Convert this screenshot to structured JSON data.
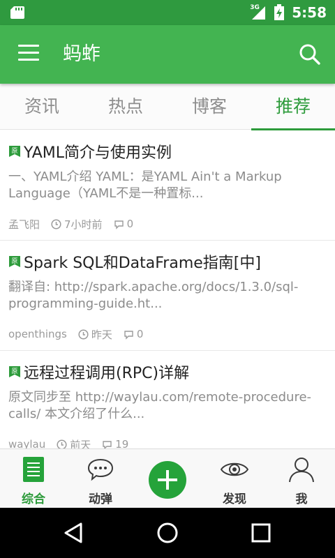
{
  "status_bar": {
    "network": "3G",
    "time": "5:58",
    "icons": [
      "sd-card-icon",
      "signal-icon",
      "battery-charging-icon"
    ]
  },
  "app_bar": {
    "title": "蚂蚱",
    "icons": [
      "menu-icon",
      "search-icon"
    ]
  },
  "tabs": [
    {
      "label": "资讯",
      "active": false
    },
    {
      "label": "热点",
      "active": false
    },
    {
      "label": "博客",
      "active": false
    },
    {
      "label": "推荐",
      "active": true
    }
  ],
  "articles": [
    {
      "badge": "原",
      "title": "YAML简介与使用实例",
      "summary": "一、YAML介绍 YAML：是YAML Ain't a Markup Language（YAML不是一种置标...",
      "author": "孟飞阳",
      "time": "7小时前",
      "comments": "0"
    },
    {
      "badge": "原",
      "title": "Spark SQL和DataFrame指南[中]",
      "summary": "翻译自: http://spark.apache.org/docs/1.3.0/sql-programming-guide.ht...",
      "author": "openthings",
      "time": "昨天",
      "comments": "0"
    },
    {
      "badge": "原",
      "title": "远程过程调用(RPC)详解",
      "summary": "原文同步至 http://waylau.com/remote-procedure-calls/ 本文介绍了什么...",
      "author": "waylau",
      "time": "前天",
      "comments": "19"
    }
  ],
  "bottom_nav": {
    "items": [
      {
        "label": "综合",
        "icon": "document-icon",
        "active": true
      },
      {
        "label": "动弹",
        "icon": "chat-bubble-icon",
        "active": false
      },
      {
        "label": "发现",
        "icon": "eye-icon",
        "active": false
      },
      {
        "label": "我",
        "icon": "person-icon",
        "active": false
      }
    ],
    "center_action_icon": "plus-icon"
  },
  "system_nav": [
    "back-icon",
    "home-icon",
    "recents-icon"
  ],
  "colors": {
    "status_bar": "#2f9a3f",
    "app_bar": "#43b451",
    "accent": "#2d9b3b",
    "fab": "#25a33a",
    "system_nav": "#000000"
  }
}
